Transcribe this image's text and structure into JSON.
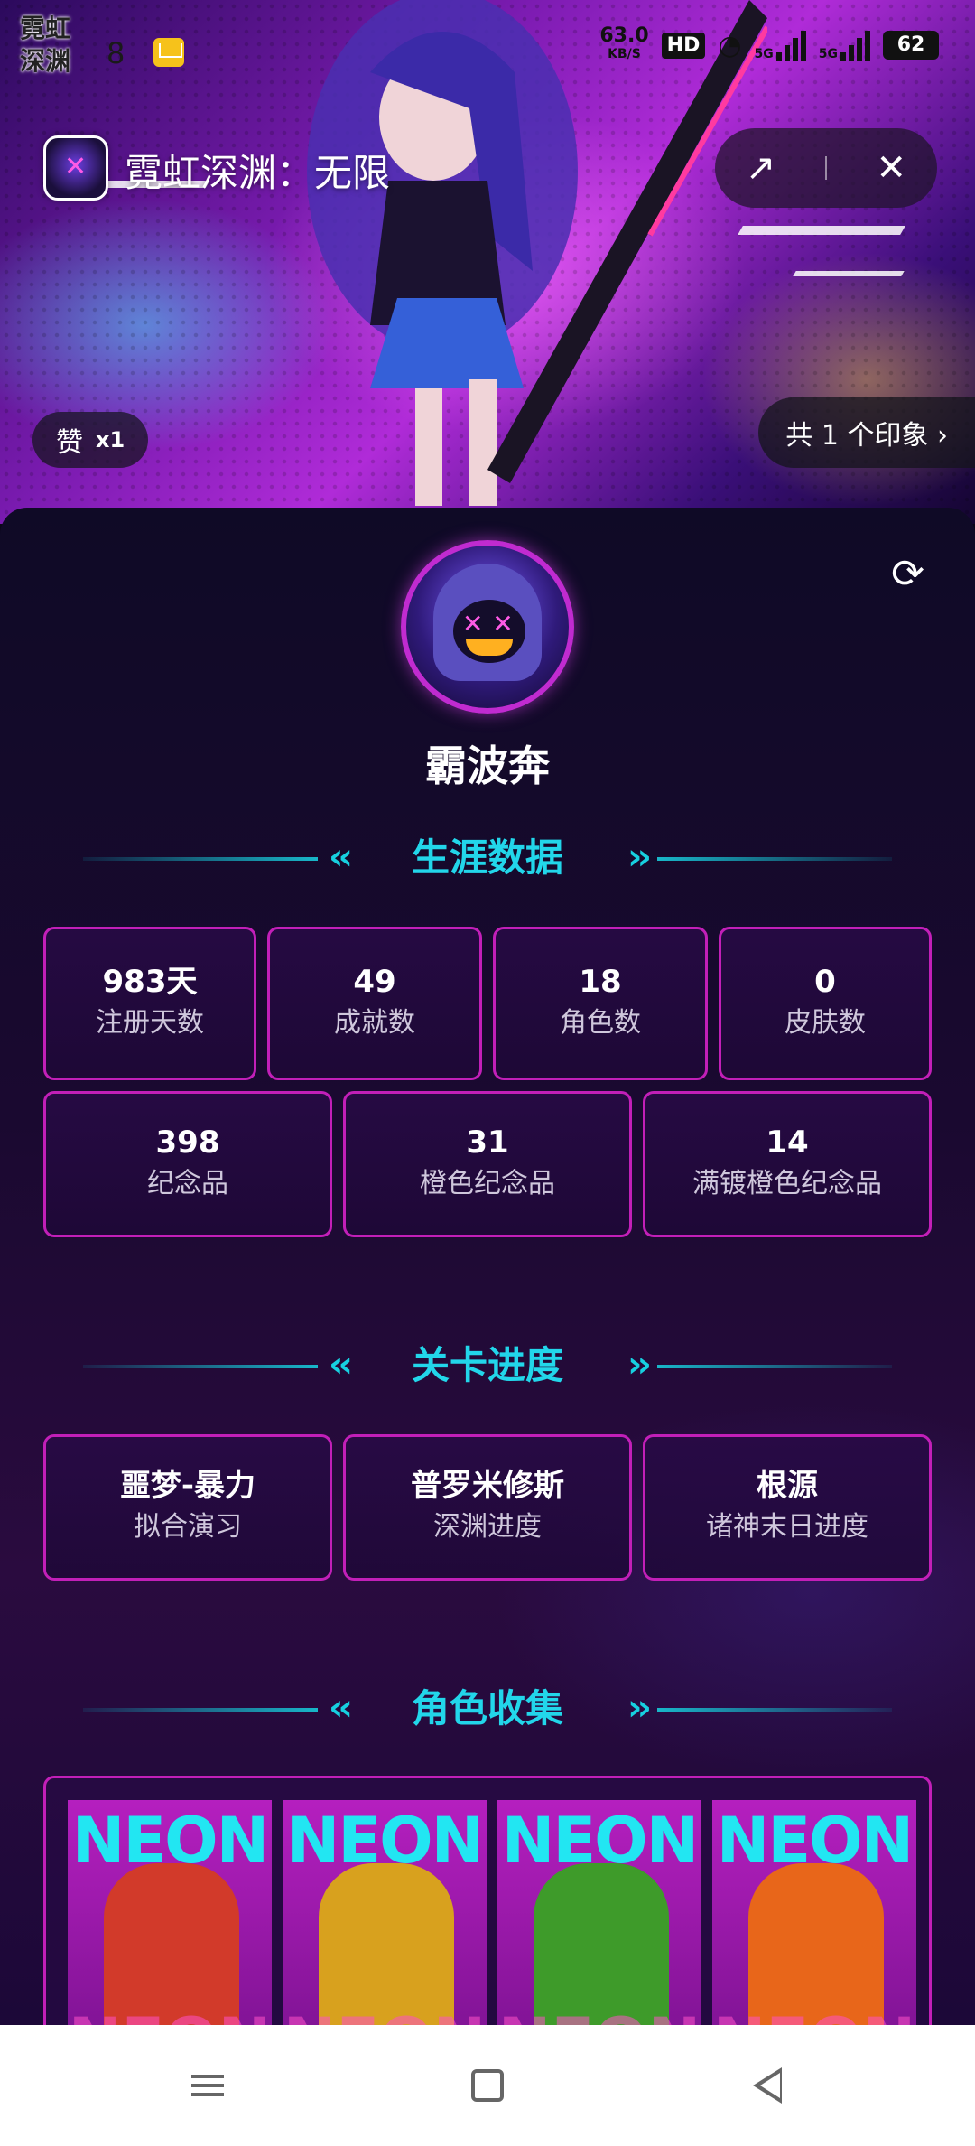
{
  "status_bar": {
    "app_badge_line1": "霓虹",
    "app_badge_line2": "深渊",
    "time_fragment": "8",
    "speed_value": "63.0",
    "speed_unit": "KB/S",
    "hd": "HD",
    "net1": "5G",
    "net2": "5G",
    "battery": "62"
  },
  "header": {
    "app_title": "霓虹深渊：无限",
    "like_label": "赞",
    "like_count": "x1",
    "impression_link": "共 1 个印象 ›"
  },
  "profile": {
    "username": "霸波奔"
  },
  "career": {
    "title": "生涯数据",
    "row1": [
      {
        "value": "983天",
        "label": "注册天数"
      },
      {
        "value": "49",
        "label": "成就数"
      },
      {
        "value": "18",
        "label": "角色数"
      },
      {
        "value": "0",
        "label": "皮肤数"
      }
    ],
    "row2": [
      {
        "value": "398",
        "label": "纪念品"
      },
      {
        "value": "31",
        "label": "橙色纪念品"
      },
      {
        "value": "14",
        "label": "满镀橙色纪念品"
      }
    ]
  },
  "progress": {
    "title": "关卡进度",
    "items": [
      {
        "value": "噩梦-暴力",
        "label": "拟合演习"
      },
      {
        "value": "普罗米修斯",
        "label": "深渊进度"
      },
      {
        "value": "根源",
        "label": "诸神末日进度"
      }
    ]
  },
  "collection": {
    "title": "角色收集",
    "card_text": "NEON",
    "heroes": [
      {
        "icon": "gunner-hero-icon",
        "color": "#d23a2a"
      },
      {
        "icon": "blonde-gunner-hero-icon",
        "color": "#d8a11e"
      },
      {
        "icon": "brawler-hero-icon",
        "color": "#3e9b2a"
      },
      {
        "icon": "fighter-hero-icon",
        "color": "#e8661a"
      }
    ]
  },
  "colors": {
    "accent_cyan": "#22d6ea",
    "card_border": "#c21fb8"
  }
}
